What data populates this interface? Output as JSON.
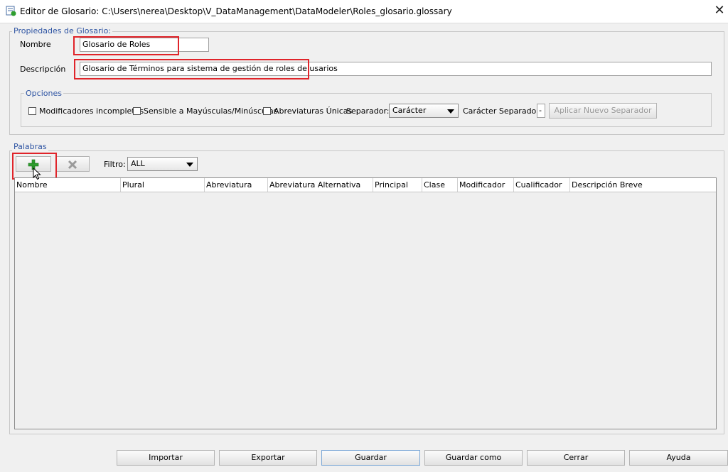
{
  "window": {
    "title": "Editor de Glosario: C:\\Users\\nerea\\Desktop\\V_DataManagement\\DataModeler\\Roles_glosario.glossary",
    "icon": "glossary-editor-icon",
    "close_glyph": "✕"
  },
  "properties": {
    "legend": "Propiedades de Glosario:",
    "name_label": "Nombre",
    "name_value": "Glosario de Roles",
    "description_label": "Descripción",
    "description_value": "Glosario de Términos para sistema de gestión de roles de usarios"
  },
  "options": {
    "legend": "Opciones",
    "incomplete_modifiers": "Modificadores incompletos",
    "case_sensitive": "Sensible a Mayúsculas/Minúsculas",
    "unique_abbreviations": "Abreviaturas Únicas",
    "separator_label": "Separador:",
    "separator_value": "Carácter",
    "separator_char_label": "Carácter Separador:",
    "separator_char_value": "-",
    "apply_button": "Aplicar Nuevo Separador"
  },
  "words": {
    "legend": "Palabras",
    "add_icon": "plus-icon",
    "delete_icon": "delete-x-icon",
    "filter_label": "Filtro:",
    "filter_value": "ALL",
    "columns": [
      "Nombre",
      "Plural",
      "Abreviatura",
      "Abreviatura Alternativa",
      "Principal",
      "Clase",
      "Modificador",
      "Cualificador",
      "Descripción Breve"
    ]
  },
  "footer": {
    "import": "Importar",
    "export": "Exportar",
    "save": "Guardar",
    "save_as": "Guardar como",
    "close": "Cerrar",
    "help": "Ayuda"
  },
  "colors": {
    "highlight": "#e0242a",
    "legend_text": "#2f55a3",
    "plus_green": "#2e9e2e"
  }
}
